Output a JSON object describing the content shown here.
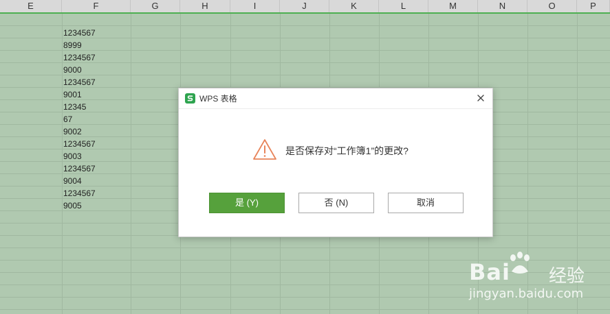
{
  "column_headers": [
    "E",
    "F",
    "G",
    "H",
    "I",
    "J",
    "K",
    "L",
    "M",
    "N",
    "O",
    "P"
  ],
  "cells": [
    "1234567",
    "8999",
    "1234567",
    "9000",
    "1234567",
    "9001",
    "12345",
    "67",
    "9002",
    "1234567",
    "9003",
    "1234567",
    "9004",
    "1234567",
    "9005"
  ],
  "dialog": {
    "title": "WPS 表格",
    "message": "是否保存对“工作簿1”的更改?",
    "yes_label": "是 (Y)",
    "no_label": "否 (N)",
    "cancel_label": "取消"
  },
  "watermark": {
    "brand": "Bai",
    "brand_suffix": "经验",
    "url": "jingyan.baidu.com"
  },
  "colors": {
    "sheet_background": "#b0c9b0",
    "accent": "#4caf50",
    "primary_button": "#56a13c",
    "warning_icon": "#e8845a"
  }
}
